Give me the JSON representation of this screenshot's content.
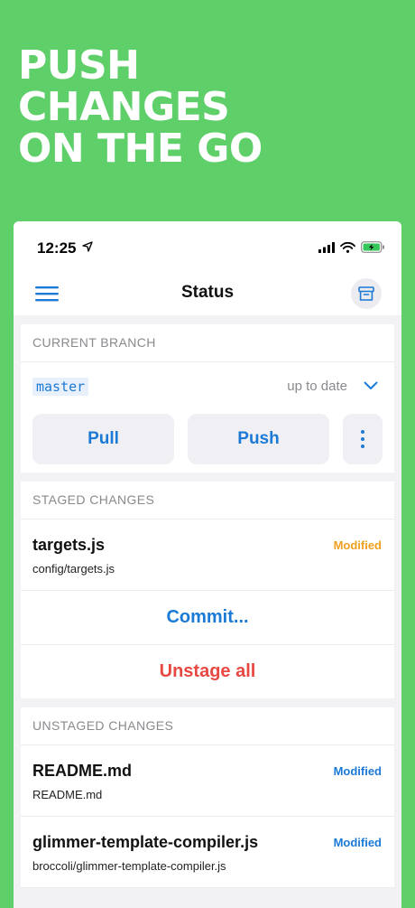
{
  "headline": {
    "line1": "PUSH",
    "line2": "CHANGES",
    "line3": "ON THE GO"
  },
  "status_bar": {
    "time": "12:25",
    "icons": [
      "location-arrow-icon",
      "cellular-signal-icon",
      "wifi-icon",
      "battery-charging-icon"
    ],
    "battery_color": "#34c759"
  },
  "nav": {
    "title": "Status",
    "left_icon": "menu-icon",
    "right_icon": "archive-icon"
  },
  "current_branch": {
    "header": "CURRENT BRANCH",
    "name": "master",
    "status": "up to date",
    "pull_label": "Pull",
    "push_label": "Push",
    "more_icon": "more-vertical-icon"
  },
  "staged": {
    "header": "STAGED CHANGES",
    "files": [
      {
        "name": "targets.js",
        "path": "config/targets.js",
        "badge": "Modified",
        "badge_color": "#f0a020"
      }
    ],
    "commit_label": "Commit...",
    "unstage_label": "Unstage all"
  },
  "unstaged": {
    "header": "UNSTAGED CHANGES",
    "files": [
      {
        "name": "README.md",
        "path": "README.md",
        "badge": "Modified",
        "badge_color": "#1b7ad6"
      },
      {
        "name": "glimmer-template-compiler.js",
        "path": "broccoli/glimmer-template-compiler.js",
        "badge": "Modified",
        "badge_color": "#1b7ad6"
      }
    ]
  },
  "colors": {
    "background": "#5fcf6a",
    "accent": "#1b7ad6",
    "destructive": "#e74842",
    "staged_badge": "#f0a020"
  }
}
